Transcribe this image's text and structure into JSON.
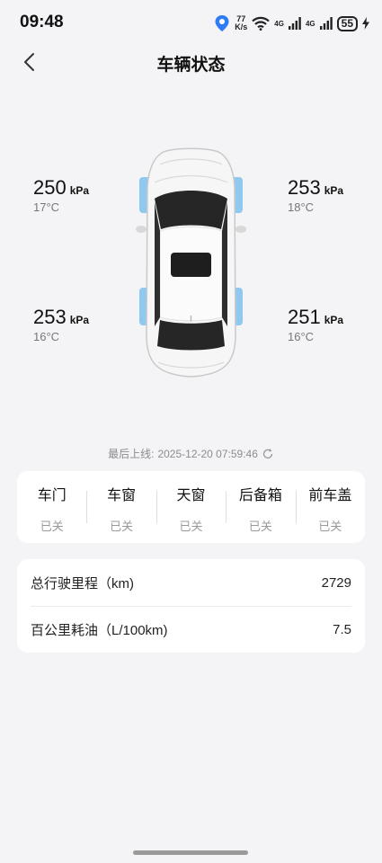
{
  "status_bar": {
    "time": "09:48",
    "net_speed_value": "77",
    "net_speed_unit": "K/s",
    "net_type_1": "4G",
    "net_type_2": "4G",
    "battery": "55"
  },
  "header": {
    "title": "车辆状态"
  },
  "tires": {
    "unit": "kPa",
    "front_left": {
      "pressure": "250",
      "temp": "17°C"
    },
    "front_right": {
      "pressure": "253",
      "temp": "18°C"
    },
    "rear_left": {
      "pressure": "253",
      "temp": "16°C"
    },
    "rear_right": {
      "pressure": "251",
      "temp": "16°C"
    }
  },
  "last_online": {
    "label": "最后上线:",
    "value": "2025-12-20 07:59:46"
  },
  "doors": [
    {
      "name": "车门",
      "state": "已关"
    },
    {
      "name": "车窗",
      "state": "已关"
    },
    {
      "name": "天窗",
      "state": "已关"
    },
    {
      "name": "后备箱",
      "state": "已关"
    },
    {
      "name": "前车盖",
      "state": "已关"
    }
  ],
  "stats": [
    {
      "label": "总行驶里程（km)",
      "value": "2729"
    },
    {
      "label": "百公里耗油（L/100km)",
      "value": "7.5"
    }
  ],
  "colors": {
    "background": "#f4f4f6",
    "tire_highlight": "#8fc9f0",
    "location_pin": "#2f7cf6"
  }
}
